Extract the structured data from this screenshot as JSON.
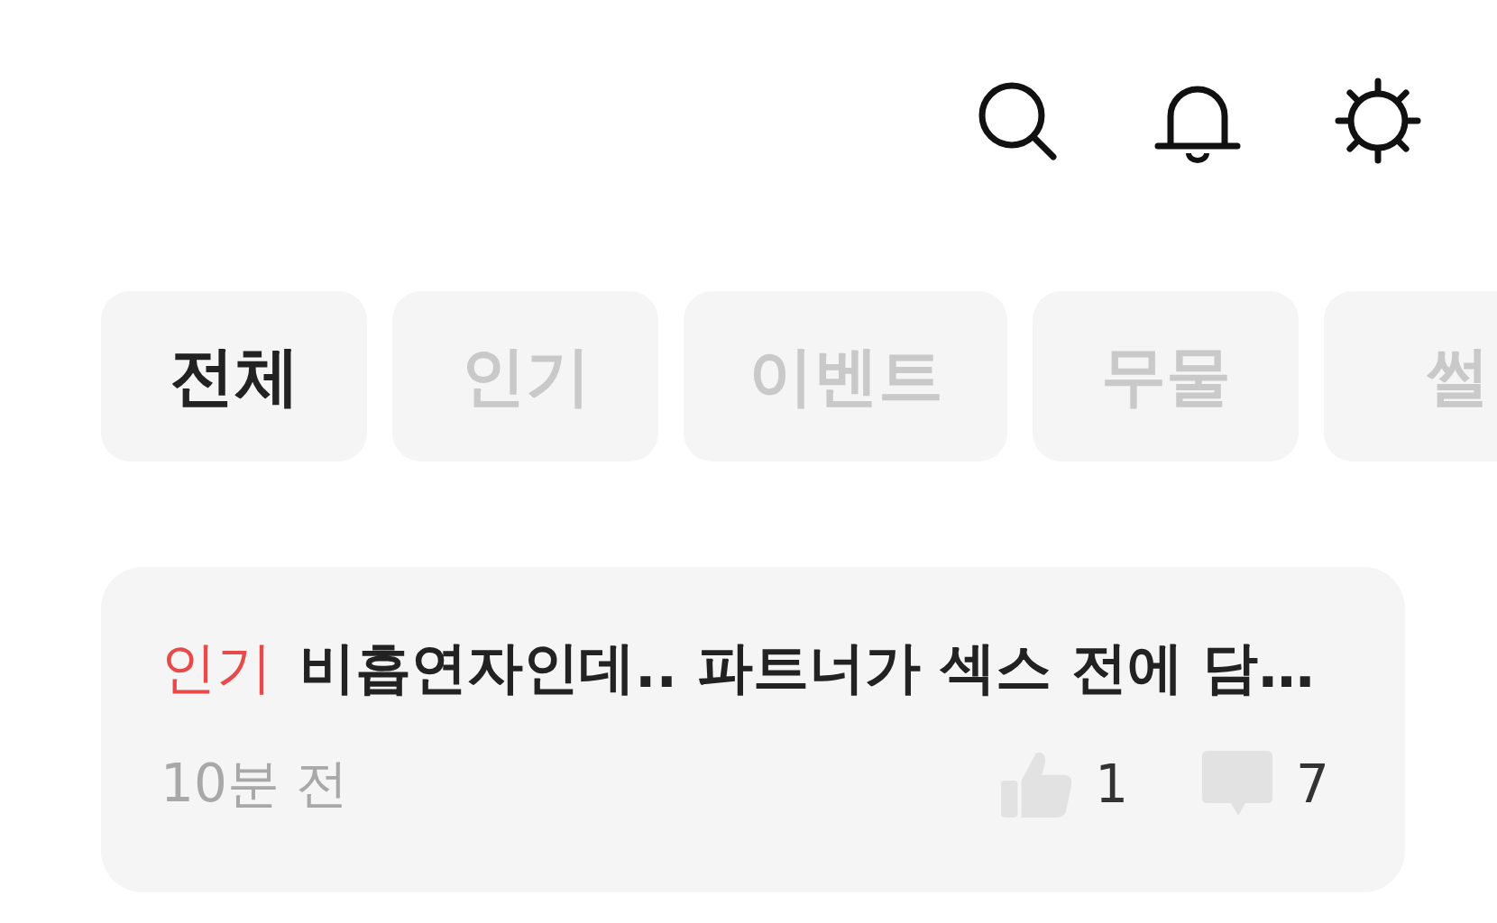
{
  "tabs": [
    {
      "label": "전체",
      "selected": true
    },
    {
      "label": "인기",
      "selected": false
    },
    {
      "label": "이벤트",
      "selected": false
    },
    {
      "label": "무물",
      "selected": false
    },
    {
      "label": "썰",
      "selected": false
    }
  ],
  "posts": [
    {
      "badge": "인기",
      "title": "비흡연자인데.. 파트너가 섹스 전에 담…",
      "time": "10분 전",
      "likes": "1",
      "comments": "7"
    }
  ]
}
